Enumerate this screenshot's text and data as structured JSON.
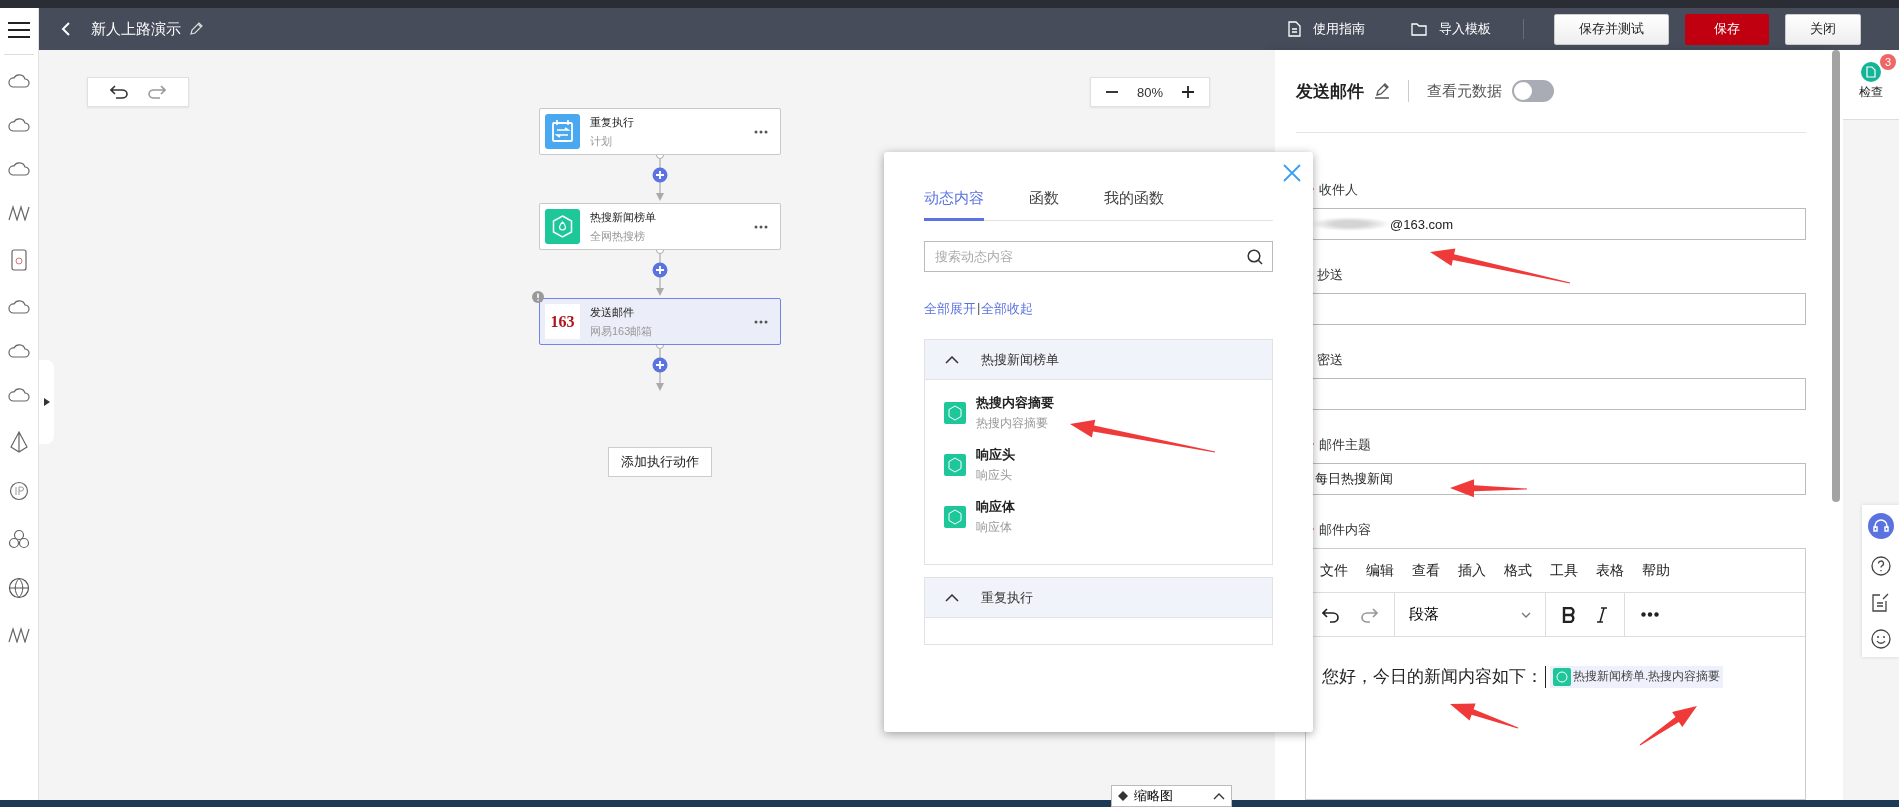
{
  "header": {
    "title": "新人上路演示",
    "actions": [
      {
        "label": "使用指南",
        "kind": "guide"
      },
      {
        "label": "导入模板",
        "kind": "import"
      }
    ],
    "buttons": [
      {
        "label": "保存并测试",
        "kind": "default"
      },
      {
        "label": "保存",
        "kind": "primary"
      },
      {
        "label": "关闭",
        "kind": "default"
      }
    ]
  },
  "canvas": {
    "zoom": "80%",
    "nodes": [
      {
        "title": "重复执行",
        "subtitle": "计划",
        "kind": "schedule",
        "selected": false,
        "warning": false
      },
      {
        "title": "热搜新闻榜单",
        "subtitle": "全网热搜榜",
        "kind": "hot",
        "selected": false,
        "warning": false
      },
      {
        "title": "发送邮件",
        "subtitle": "网易163邮箱",
        "kind": "mail",
        "icon_text": "163",
        "selected": true,
        "warning": true
      }
    ],
    "add_button": "添加执行动作",
    "minimap_button": "缩略图"
  },
  "popup": {
    "tabs": [
      {
        "label": "动态内容",
        "selected": true
      },
      {
        "label": "函数",
        "selected": false
      },
      {
        "label": "我的函数",
        "selected": false
      }
    ],
    "search": {
      "placeholder": "搜索动态内容"
    },
    "expand_all": "全部展开",
    "separator": "|",
    "collapse_all": "全部收起",
    "groups": [
      {
        "name": "热搜新闻榜单",
        "expanded": true,
        "items": [
          {
            "title": "热搜内容摘要",
            "subtitle": "热搜内容摘要"
          },
          {
            "title": "响应头",
            "subtitle": "响应头"
          },
          {
            "title": "响应体",
            "subtitle": "响应体"
          }
        ]
      },
      {
        "name": "重复执行",
        "expanded": true
      }
    ]
  },
  "panel": {
    "title": "发送邮件",
    "metadata_toggle": {
      "label": "查看元数据",
      "on": false
    },
    "fields": [
      {
        "label": "收件人",
        "required": true,
        "value": "@163.com",
        "blurred": true
      },
      {
        "label": "抄送",
        "required": false
      },
      {
        "label": "密送",
        "required": false
      },
      {
        "label": "邮件主题",
        "required": true,
        "value": "每日热搜新闻",
        "blurred": false
      }
    ],
    "content": {
      "label": "邮件内容",
      "required": true,
      "menu": [
        "文件",
        "编辑",
        "查看",
        "插入",
        "格式",
        "工具",
        "表格",
        "帮助"
      ],
      "block_format": "段落",
      "text": "您好，今日的新闻内容如下：",
      "token": "热搜新闻榜单.热搜内容摘要"
    }
  },
  "inspector": {
    "label": "检查",
    "badge": "3"
  }
}
